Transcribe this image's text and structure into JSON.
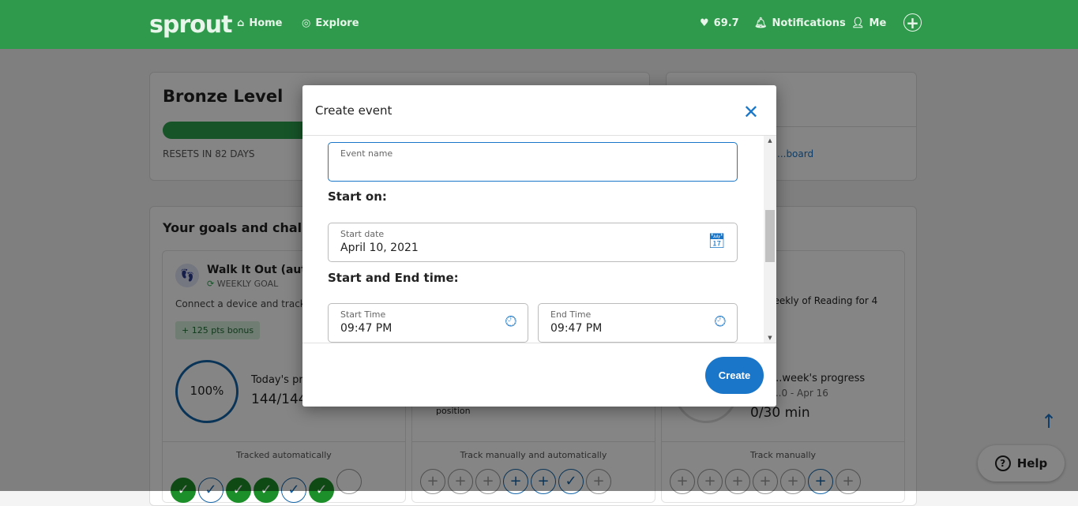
{
  "nav": {
    "logo": "sprout",
    "home": "Home",
    "explore": "Explore",
    "points": "69.7",
    "notifications": "Notifications",
    "me": "Me"
  },
  "level": {
    "title": "Bronze Level",
    "resets": "RESETS IN 82 DAYS",
    "progress_pct": 45
  },
  "leaderboard": {
    "link": "...board"
  },
  "goals": {
    "title": "Your goals and challenges",
    "cards": [
      {
        "title": "Walk It Out (automatic)",
        "type": "WEEKLY GOAL",
        "desc": "Connect a device and track...",
        "bonus": "+ 125 pts bonus",
        "pct": "100%",
        "today": "Today's progress",
        "value": "144/144",
        "tracking": "Tracked automatically",
        "days": [
          "done",
          "check",
          "done",
          "done",
          "check",
          "done",
          "empty"
        ]
      },
      {
        "position": "position",
        "tracking": "Track manually and automatically",
        "days": [
          "plus",
          "plus",
          "plus",
          "plus-b",
          "plus-b",
          "check",
          "plus"
        ]
      },
      {
        "desc": "...eekly of Reading for 4",
        "week": "...week's progress",
        "range": "...0 - Apr 16",
        "value": "0/30 min",
        "tracking": "Track manually",
        "days": [
          "plus",
          "plus",
          "plus",
          "plus",
          "plus",
          "plus-b",
          "plus"
        ]
      }
    ]
  },
  "help": {
    "label": "Help"
  },
  "modal": {
    "title": "Create event",
    "event_name_label": "Event name",
    "event_name_value": "",
    "start_on": "Start on:",
    "start_date_label": "Start date",
    "start_date": "April 10, 2021",
    "time_heading": "Start and End time:",
    "start_time_label": "Start Time",
    "start_time": "09:47 PM",
    "end_time_label": "End Time",
    "end_time": "09:47 PM",
    "create": "Create"
  }
}
